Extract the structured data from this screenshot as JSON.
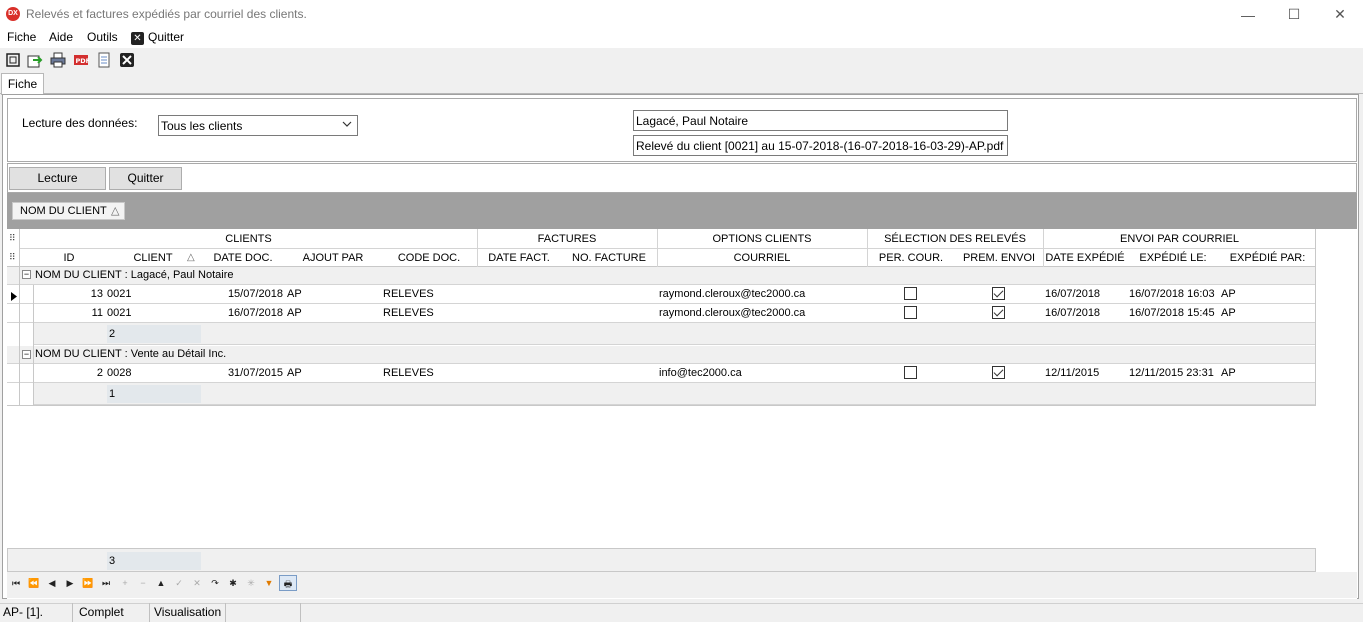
{
  "window": {
    "app_icon_text": "DX",
    "title": "Relevés et factures expédiés par courriel des clients.",
    "minimize_glyph": "—",
    "maximize_glyph": "☐",
    "close_glyph": "✕"
  },
  "menu": {
    "items": [
      "Fiche",
      "Aide",
      "Outils"
    ],
    "quit_label": "Quitter"
  },
  "toolbar": {
    "icons": [
      "select-icon",
      "export-icon",
      "print-icon",
      "pdf-icon",
      "document-icon",
      "close-icon"
    ]
  },
  "tabs": {
    "active": "Fiche"
  },
  "filters": {
    "read_label": "Lecture des données:",
    "client_select_value": "Tous les clients",
    "client_name": "Lagacé, Paul Notaire",
    "file_name": "Relevé du client [0021] au 15-07-2018-(16-07-2018-16-03-29)-AP.pdf"
  },
  "buttons": {
    "read": "Lecture",
    "quit": "Quitter"
  },
  "groupbar": {
    "chip_label": "NOM DU CLIENT",
    "chip_sort": "△"
  },
  "grid": {
    "bands": {
      "clients": "CLIENTS",
      "factures": "FACTURES",
      "options": "OPTIONS CLIENTS",
      "selection": "SÉLECTION DES RELEVÉS",
      "envoi": "ENVOI PAR COURRIEL"
    },
    "columns": {
      "id": "ID",
      "client": "CLIENT",
      "client_sort": "△",
      "date_doc": "DATE  DOC.",
      "ajout_par": "AJOUT PAR",
      "code_doc": "CODE DOC.",
      "date_fact": "DATE FACT.",
      "no_facture": "NO. FACTURE",
      "courriel": "COURRIEL",
      "per_cour": "PER. COUR.",
      "prem_envoi": "PREM. ENVOI",
      "date_expedie": "DATE EXPÉDIÉ",
      "expedie_le": "EXPÉDIÉ LE:",
      "expedie_par": "EXPÉDIÉ PAR:"
    },
    "groups": [
      {
        "label": "NOM DU CLIENT : Lagacé, Paul Notaire",
        "count": "2",
        "rows": [
          {
            "id": "13",
            "client": "0021",
            "date_doc": "15/07/2018",
            "ajout_par": "AP",
            "code_doc": "RELEVES",
            "date_fact": "",
            "no_facture": "",
            "courriel": "raymond.cleroux@tec2000.ca",
            "per_cour": false,
            "prem_envoi": true,
            "date_expedie": "16/07/2018",
            "expedie_le": "16/07/2018 16:03",
            "expedie_par": "AP"
          },
          {
            "id": "11",
            "client": "0021",
            "date_doc": "16/07/2018",
            "ajout_par": "AP",
            "code_doc": "RELEVES",
            "date_fact": "",
            "no_facture": "",
            "courriel": "raymond.cleroux@tec2000.ca",
            "per_cour": false,
            "prem_envoi": true,
            "date_expedie": "16/07/2018",
            "expedie_le": "16/07/2018 15:45",
            "expedie_par": "AP"
          }
        ]
      },
      {
        "label": "NOM DU CLIENT : Vente au Détail Inc.",
        "count": "1",
        "rows": [
          {
            "id": "2",
            "client": "0028",
            "date_doc": "31/07/2015",
            "ajout_par": "AP",
            "code_doc": "RELEVES",
            "date_fact": "",
            "no_facture": "",
            "courriel": "info@tec2000.ca",
            "per_cour": false,
            "prem_envoi": true,
            "date_expedie": "12/11/2015",
            "expedie_le": "12/11/2015 23:31",
            "expedie_par": "AP"
          }
        ]
      }
    ],
    "total_count": "3"
  },
  "navigator": {
    "buttons": [
      "⏮",
      "⏪",
      "◀",
      "▶",
      "⏩",
      "⏭",
      "+",
      "−",
      "▲",
      "✓",
      "✕",
      "↷",
      "✱",
      "✳",
      "▼",
      "🖶"
    ]
  },
  "status": {
    "user": "AP- [1].",
    "state": "Complet",
    "mode": "Visualisation"
  }
}
